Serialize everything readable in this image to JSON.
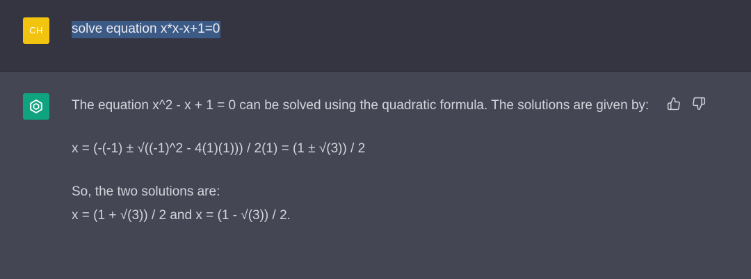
{
  "user": {
    "avatar_initials": "CH",
    "message": "solve equation x*x-x+1=0"
  },
  "assistant": {
    "avatar_icon": "openai-logo-icon",
    "paragraph1": "The equation x^2 - x + 1 = 0 can be solved using the quadratic formula. The solutions are given by:",
    "formula": "x = (-(-1) ± √((-1)^2 - 4(1)(1))) / 2(1) = (1 ± √(3)) / 2",
    "paragraph3_line1": "So, the two solutions are:",
    "paragraph3_line2": "x = (1 + √(3)) / 2 and x = (1 - √(3)) / 2."
  },
  "feedback": {
    "thumbs_up_icon": "thumbs-up-icon",
    "thumbs_down_icon": "thumbs-down-icon"
  },
  "colors": {
    "user_row_bg": "#343541",
    "assistant_row_bg": "#444654",
    "user_avatar_bg": "#f2c40f",
    "bot_avatar_bg": "#10a37f",
    "selection_bg": "#3c5a86",
    "text": "#d1d5db"
  }
}
